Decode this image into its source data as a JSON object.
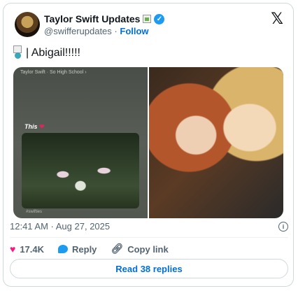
{
  "header": {
    "name": "Taylor Swift Updates",
    "handle": "@swifferupdates",
    "separator": "·",
    "follow_label": "Follow",
    "x_logo": "𝕏"
  },
  "tweet": {
    "text": "| Abigail!!!!!"
  },
  "media": {
    "story_top": "Taylor Swift · So High School ›",
    "story_caption": "This",
    "story_footer": "#swifties"
  },
  "meta": {
    "timestamp": "12:41 AM · Aug 27, 2025"
  },
  "actions": {
    "likes": "17.4K",
    "reply_label": "Reply",
    "copy_link_label": "Copy link"
  },
  "read_replies": "Read 38 replies",
  "colors": {
    "accent": "#1d9bf0",
    "link": "#006fd6",
    "heart": "#f91880",
    "muted": "#536471",
    "border": "#cfd9de"
  }
}
